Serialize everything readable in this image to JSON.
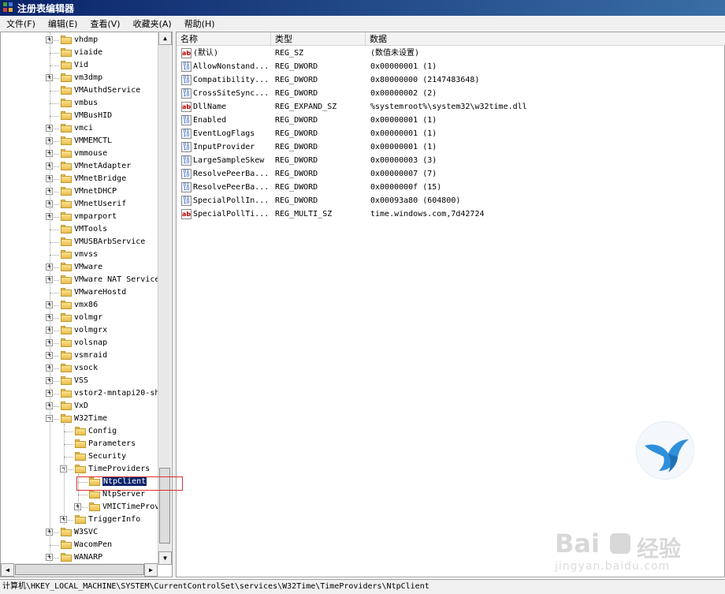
{
  "window": {
    "title": "注册表编辑器"
  },
  "menu": [
    {
      "label": "文件(F)"
    },
    {
      "label": "编辑(E)"
    },
    {
      "label": "查看(V)"
    },
    {
      "label": "收藏夹(A)"
    },
    {
      "label": "帮助(H)"
    }
  ],
  "tree": {
    "items": [
      {
        "label": "vhdmp",
        "expandable": true
      },
      {
        "label": "viaide",
        "expandable": false
      },
      {
        "label": "Vid",
        "expandable": false
      },
      {
        "label": "vm3dmp",
        "expandable": true
      },
      {
        "label": "VMAuthdService",
        "expandable": false
      },
      {
        "label": "vmbus",
        "expandable": false
      },
      {
        "label": "VMBusHID",
        "expandable": false
      },
      {
        "label": "vmci",
        "expandable": true
      },
      {
        "label": "VMMEMCTL",
        "expandable": true
      },
      {
        "label": "vmmouse",
        "expandable": true
      },
      {
        "label": "VMnetAdapter",
        "expandable": true
      },
      {
        "label": "VMnetBridge",
        "expandable": true
      },
      {
        "label": "VMnetDHCP",
        "expandable": true
      },
      {
        "label": "VMnetUserif",
        "expandable": true
      },
      {
        "label": "vmparport",
        "expandable": true
      },
      {
        "label": "VMTools",
        "expandable": false
      },
      {
        "label": "VMUSBArbService",
        "expandable": false
      },
      {
        "label": "vmvss",
        "expandable": false
      },
      {
        "label": "VMware",
        "expandable": true
      },
      {
        "label": "VMware NAT Service",
        "expandable": true
      },
      {
        "label": "VMwareHostd",
        "expandable": false
      },
      {
        "label": "vmx86",
        "expandable": true
      },
      {
        "label": "volmgr",
        "expandable": true
      },
      {
        "label": "volmgrx",
        "expandable": true
      },
      {
        "label": "volsnap",
        "expandable": true
      },
      {
        "label": "vsmraid",
        "expandable": true
      },
      {
        "label": "vsock",
        "expandable": true
      },
      {
        "label": "VSS",
        "expandable": true
      },
      {
        "label": "vstor2-mntapi20-sh",
        "expandable": true
      },
      {
        "label": "VxD",
        "expandable": true
      },
      {
        "label": "W32Time",
        "expanded": true
      },
      {
        "label": "Config",
        "child": true
      },
      {
        "label": "Parameters",
        "child": true
      },
      {
        "label": "Security",
        "child": true
      },
      {
        "label": "TimeProviders",
        "child": true,
        "expanded": true
      },
      {
        "label": "NtpClient",
        "grandchild": true,
        "selected": true
      },
      {
        "label": "NtpServer",
        "grandchild": true
      },
      {
        "label": "VMICTimeProv",
        "grandchild": true,
        "expandable": true
      },
      {
        "label": "TriggerInfo",
        "child": true,
        "expandable": true
      },
      {
        "label": "W3SVC",
        "expandable": true
      },
      {
        "label": "WacomPen",
        "expandable": false
      },
      {
        "label": "WANARP",
        "expandable": true
      }
    ]
  },
  "list": {
    "columns": [
      "名称",
      "类型",
      "数据"
    ],
    "rows": [
      {
        "icon": "ab",
        "name": "(默认)",
        "type": "REG_SZ",
        "data": "(数值未设置)"
      },
      {
        "icon": "bin",
        "name": "AllowNonstand...",
        "type": "REG_DWORD",
        "data": "0x00000001 (1)"
      },
      {
        "icon": "bin",
        "name": "Compatibility...",
        "type": "REG_DWORD",
        "data": "0x80000000 (2147483648)"
      },
      {
        "icon": "bin",
        "name": "CrossSiteSync...",
        "type": "REG_DWORD",
        "data": "0x00000002 (2)"
      },
      {
        "icon": "ab",
        "name": "DllName",
        "type": "REG_EXPAND_SZ",
        "data": "%systemroot%\\system32\\w32time.dll"
      },
      {
        "icon": "bin",
        "name": "Enabled",
        "type": "REG_DWORD",
        "data": "0x00000001 (1)"
      },
      {
        "icon": "bin",
        "name": "EventLogFlags",
        "type": "REG_DWORD",
        "data": "0x00000001 (1)"
      },
      {
        "icon": "bin",
        "name": "InputProvider",
        "type": "REG_DWORD",
        "data": "0x00000001 (1)"
      },
      {
        "icon": "bin",
        "name": "LargeSampleSkew",
        "type": "REG_DWORD",
        "data": "0x00000003 (3)"
      },
      {
        "icon": "bin",
        "name": "ResolvePeerBa...",
        "type": "REG_DWORD",
        "data": "0x00000007 (7)"
      },
      {
        "icon": "bin",
        "name": "ResolvePeerBa...",
        "type": "REG_DWORD",
        "data": "0x0000000f (15)"
      },
      {
        "icon": "bin",
        "name": "SpecialPollIn...",
        "type": "REG_DWORD",
        "data": "0x00093a80 (604800)"
      },
      {
        "icon": "ab",
        "name": "SpecialPollTi...",
        "type": "REG_MULTI_SZ",
        "data": "time.windows.com,7d42724"
      }
    ]
  },
  "status": {
    "path": "计算机\\HKEY_LOCAL_MACHINE\\SYSTEM\\CurrentControlSet\\services\\W32Time\\TimeProviders\\NtpClient"
  },
  "watermark": {
    "brand": "Bai",
    "brand2": "经验",
    "url": "jingyan.baidu.com"
  },
  "colors": {
    "titlebar": "#0a246a",
    "selection": "#0a246a",
    "highlight_box": "#e03030",
    "bird": "#2f8fdb"
  }
}
